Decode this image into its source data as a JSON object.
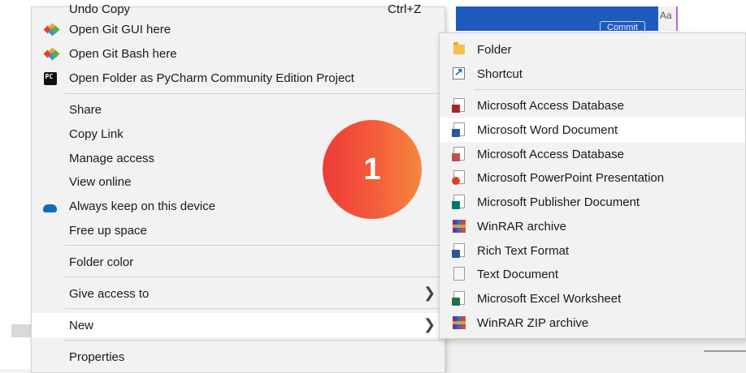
{
  "background": {
    "top_button_partial": "Commit",
    "text_style_partial": "Aa",
    "accent_blue": "#1e5bbf"
  },
  "context_menu": {
    "cut_off_top_label": "Undo Copy",
    "cut_off_top_shortcut": "Ctrl+Z",
    "items": [
      {
        "label": "Open Git GUI here",
        "icon": "git-gui-icon"
      },
      {
        "label": "Open Git Bash here",
        "icon": "git-bash-icon"
      },
      {
        "label": "Open Folder as PyCharm Community Edition Project",
        "icon": "pycharm-icon"
      },
      {
        "label": "Share"
      },
      {
        "label": "Copy Link"
      },
      {
        "label": "Manage access"
      },
      {
        "label": "View online"
      },
      {
        "label": "Always keep on this device",
        "icon": "onedrive-cloud-icon"
      },
      {
        "label": "Free up space"
      },
      {
        "label": "Folder color"
      },
      {
        "label": "Give access to",
        "has_submenu": true
      },
      {
        "label": "New",
        "has_submenu": true,
        "highlighted": true
      },
      {
        "label": "Properties"
      }
    ]
  },
  "new_submenu": {
    "items": [
      {
        "label": "Folder",
        "icon": "folder-icon"
      },
      {
        "label": "Shortcut",
        "icon": "shortcut-icon"
      },
      {
        "label": "Microsoft Access Database",
        "icon": "access-icon"
      },
      {
        "label": "Microsoft Word Document",
        "icon": "word-icon",
        "highlighted": true
      },
      {
        "label": "Microsoft Access Database",
        "icon": "access-icon"
      },
      {
        "label": "Microsoft PowerPoint Presentation",
        "icon": "powerpoint-icon"
      },
      {
        "label": "Microsoft Publisher Document",
        "icon": "publisher-icon"
      },
      {
        "label": "WinRAR archive",
        "icon": "winrar-icon"
      },
      {
        "label": "Rich Text Format",
        "icon": "rtf-icon"
      },
      {
        "label": "Text Document",
        "icon": "text-document-icon"
      },
      {
        "label": "Microsoft Excel Worksheet",
        "icon": "excel-icon"
      },
      {
        "label": "WinRAR ZIP archive",
        "icon": "winrar-zip-icon"
      }
    ]
  },
  "step_badge": {
    "number": "1",
    "colors": [
      "#f03a3a",
      "#f7883f"
    ]
  },
  "colors": {
    "menu_bg": "#f2f2f2",
    "highlight_bg": "#ffffff",
    "access": "#a4262c",
    "word": "#2b579a",
    "powerpoint": "#d24726",
    "publisher": "#077568",
    "excel": "#217346"
  }
}
